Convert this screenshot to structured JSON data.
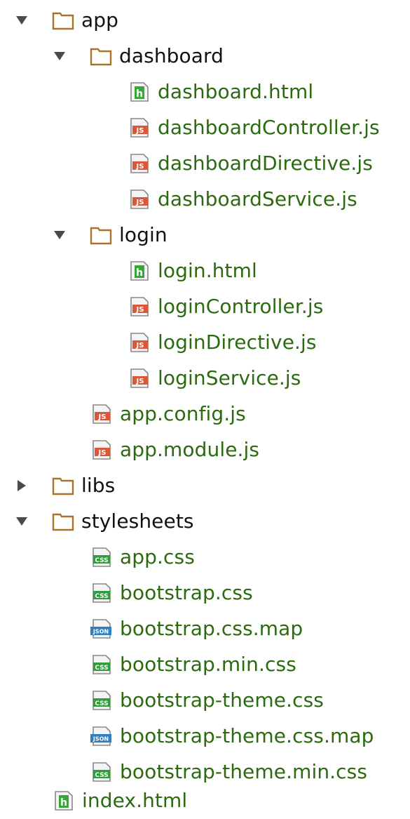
{
  "colors": {
    "folder_outline": "#a8742a",
    "file_text": "#2b6a0e",
    "folder_text": "#111111",
    "js_badge": "#d9583a",
    "css_badge": "#2f9e3a",
    "json_badge": "#2f7fc0",
    "html_badge": "#3aa63a",
    "twisty": "#4a4a4a"
  },
  "tree": {
    "app": {
      "label": "app",
      "icon": "folder-icon",
      "expanded": true
    },
    "dashboard": {
      "label": "dashboard",
      "icon": "folder-icon",
      "expanded": true,
      "files": [
        {
          "label": "dashboard.html",
          "icon": "html-file-icon"
        },
        {
          "label": "dashboardController.js",
          "icon": "js-file-icon"
        },
        {
          "label": "dashboardDirective.js",
          "icon": "js-file-icon"
        },
        {
          "label": "dashboardService.js",
          "icon": "js-file-icon"
        }
      ]
    },
    "login": {
      "label": "login",
      "icon": "folder-icon",
      "expanded": true,
      "files": [
        {
          "label": "login.html",
          "icon": "html-file-icon"
        },
        {
          "label": "loginController.js",
          "icon": "js-file-icon"
        },
        {
          "label": "loginDirective.js",
          "icon": "js-file-icon"
        },
        {
          "label": "loginService.js",
          "icon": "js-file-icon"
        }
      ]
    },
    "app_files": [
      {
        "label": "app.config.js",
        "icon": "js-file-icon"
      },
      {
        "label": "app.module.js",
        "icon": "js-file-icon"
      }
    ],
    "libs": {
      "label": "libs",
      "icon": "folder-icon",
      "expanded": false
    },
    "stylesheets": {
      "label": "stylesheets",
      "icon": "folder-icon",
      "expanded": true,
      "files": [
        {
          "label": "app.css",
          "icon": "css-file-icon"
        },
        {
          "label": "bootstrap.css",
          "icon": "css-file-icon"
        },
        {
          "label": "bootstrap.css.map",
          "icon": "json-file-icon"
        },
        {
          "label": "bootstrap.min.css",
          "icon": "css-file-icon"
        },
        {
          "label": "bootstrap-theme.css",
          "icon": "css-file-icon"
        },
        {
          "label": "bootstrap-theme.css.map",
          "icon": "json-file-icon"
        },
        {
          "label": "bootstrap-theme.min.css",
          "icon": "css-file-icon"
        }
      ]
    },
    "index": {
      "label": "index.html",
      "icon": "html-file-icon"
    }
  }
}
